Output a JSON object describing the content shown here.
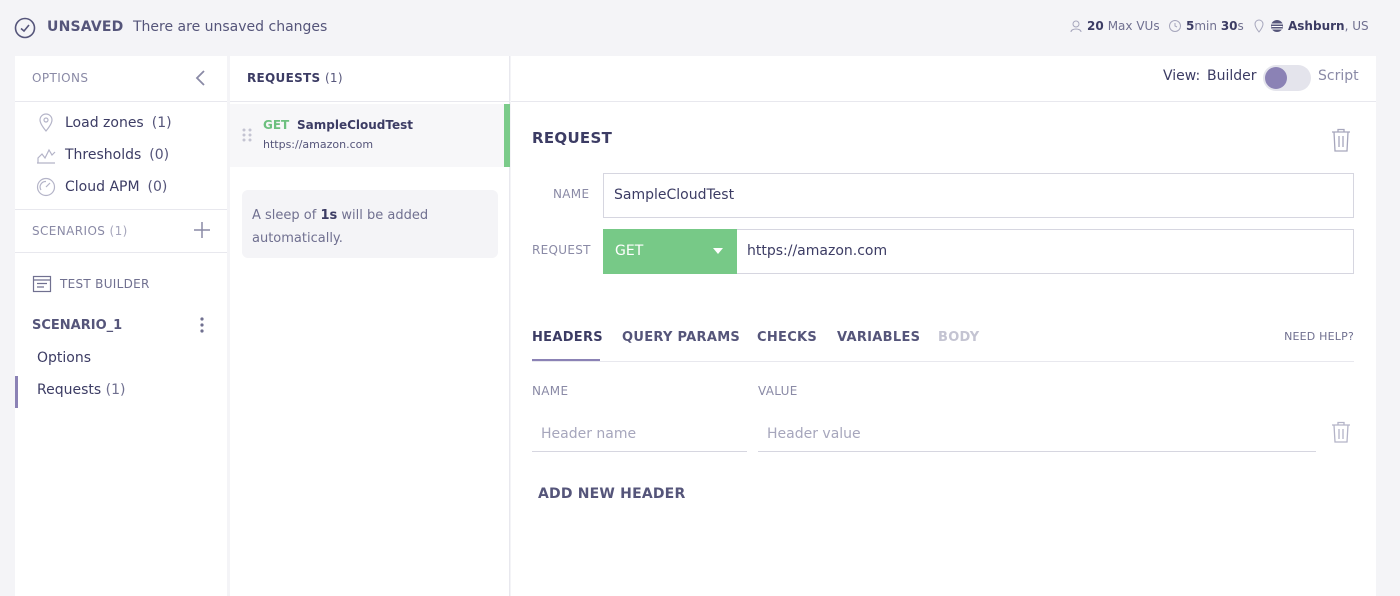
{
  "topbar": {
    "status": "UNSAVED",
    "status_desc": "There are unsaved changes",
    "vus_value": "20",
    "vus_label": "Max VUs",
    "duration_min": "5",
    "duration_min_unit": "min",
    "duration_sec": "30",
    "duration_sec_unit": "s",
    "location_city": "Ashburn",
    "location_country": ", US"
  },
  "sidebar": {
    "options_title": "OPTIONS",
    "options": [
      {
        "label": "Load zones",
        "count": "(1)"
      },
      {
        "label": "Thresholds",
        "count": "(0)"
      },
      {
        "label": "Cloud APM",
        "count": "(0)"
      }
    ],
    "scenarios_title": "SCENARIOS",
    "scenarios_count": "(1)",
    "test_builder": "TEST BUILDER",
    "scenario_name": "SCENARIO_1",
    "scenario_items": [
      {
        "label": "Options",
        "count": ""
      },
      {
        "label": "Requests",
        "count": "(1)"
      }
    ]
  },
  "requests": {
    "title": "REQUESTS",
    "count": "(1)",
    "items": [
      {
        "method": "GET",
        "name": "SampleCloudTest",
        "url": "https://amazon.com"
      }
    ],
    "sleep_prefix": "A sleep of ",
    "sleep_value": "1s",
    "sleep_suffix": " will be added automatically."
  },
  "view": {
    "label": "View:",
    "builder": "Builder",
    "script": "Script"
  },
  "request_form": {
    "heading": "REQUEST",
    "name_label": "NAME",
    "name_value": "SampleCloudTest",
    "request_label": "REQUEST",
    "method": "GET",
    "url": "https://amazon.com"
  },
  "tabs": {
    "headers": "HEADERS",
    "query_params": "QUERY PARAMS",
    "checks": "CHECKS",
    "variables": "VARIABLES",
    "body": "BODY",
    "need_help": "NEED HELP?"
  },
  "headers_table": {
    "name_col": "NAME",
    "value_col": "VALUE",
    "name_placeholder": "Header name",
    "value_placeholder": "Header value",
    "add_label": "ADD NEW HEADER"
  },
  "colors": {
    "accent": "#8b82b5",
    "get_green": "#77c987",
    "text": "#3c3c64"
  }
}
